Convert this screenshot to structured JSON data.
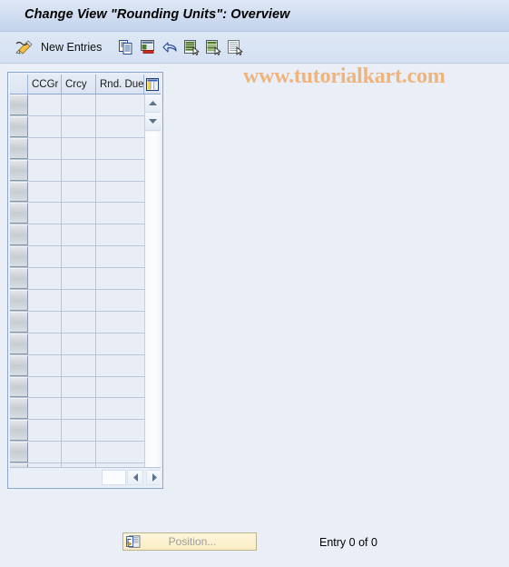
{
  "window": {
    "title": "Change View \"Rounding Units\": Overview"
  },
  "toolbar": {
    "pencil_icon": "pencil-display-change-icon",
    "new_entries_label": "New Entries",
    "copy_icon": "copy-as-icon",
    "delete_icon": "delete-row-icon",
    "undo_icon": "undo-icon",
    "select_all_icon": "select-all-icon",
    "select_block_icon": "select-block-icon",
    "deselect_all_icon": "deselect-all-icon"
  },
  "watermark": {
    "text": "www.tutorialkart.com",
    "color": "#eeb47e"
  },
  "table": {
    "columns": [
      {
        "key": "select",
        "label": ""
      },
      {
        "key": "ccgr",
        "label": "CCGr"
      },
      {
        "key": "crcy",
        "label": "Crcy"
      },
      {
        "key": "rnd_due",
        "label": "Rnd. Due"
      }
    ],
    "config_icon": "column-configuration-icon",
    "rows": [],
    "empty_row_count": 18,
    "vertical_scrollbar": {
      "up_icon": "scroll-up-icon",
      "down_icon": "scroll-down-icon"
    },
    "horizontal_scrollbar": {
      "left_icon": "scroll-left-icon",
      "right_icon": "scroll-right-icon"
    }
  },
  "footer": {
    "position_button_label": "Position...",
    "position_button_icon": "position-icon",
    "position_button_enabled": false,
    "entry_count_text": "Entry 0 of 0"
  }
}
